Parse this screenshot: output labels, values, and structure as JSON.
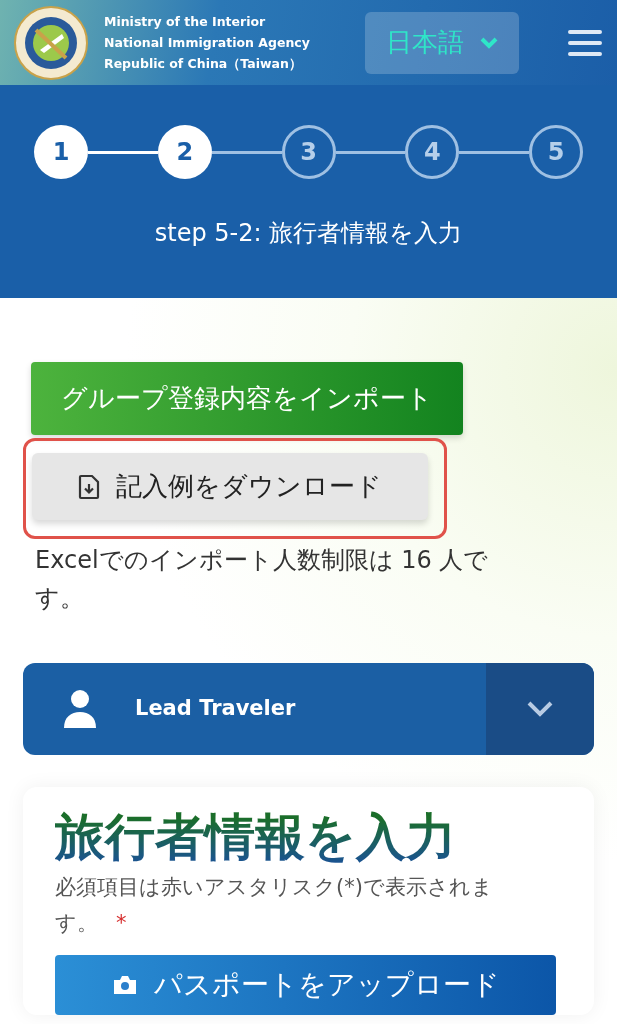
{
  "header": {
    "agency_lines": [
      "Ministry of the Interior",
      "National Immigration Agency",
      "Republic of China（Taiwan）"
    ],
    "language": "日本語"
  },
  "steps": [
    {
      "label": "1",
      "reached": true
    },
    {
      "label": "2",
      "reached": true
    },
    {
      "label": "3",
      "reached": false
    },
    {
      "label": "4",
      "reached": false
    },
    {
      "label": "5",
      "reached": false
    }
  ],
  "step_caption": "step 5-2: 旅行者情報を入力",
  "import_button": "グループ登録内容をインポート",
  "download_button": {
    "label": "記入例をダウンロード",
    "highlighted": true
  },
  "import_note": "Excelでのインポート人数制限は 16 人です。",
  "traveler_panel": {
    "title": "Lead Traveler",
    "expanded": false
  },
  "form": {
    "title": "旅行者情報を入力",
    "note": "必須項目は赤いアスタリスク(*)で表示されます。",
    "required_mark": "*",
    "upload_button": "パスポートをアップロード"
  }
}
